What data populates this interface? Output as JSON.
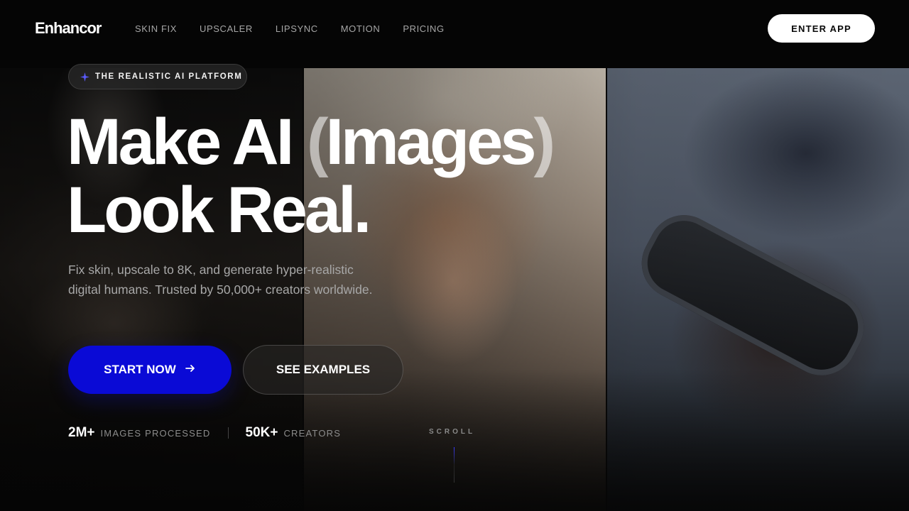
{
  "nav": {
    "logo": "Enhancor",
    "links": [
      "SKIN FIX",
      "UPSCALER",
      "LIPSYNC",
      "MOTION",
      "PRICING"
    ],
    "enter_app": "ENTER APP"
  },
  "hero": {
    "badge_icon": "sparkle-icon",
    "badge": "THE REALISTIC AI PLATFORM",
    "headline_line1_a": "Make AI ",
    "headline_paren_open": "(",
    "headline_images": "Images",
    "headline_paren_close": ")",
    "headline_line2": "Look Real.",
    "subtext": "Fix skin, upscale to 8K, and generate hyper-realistic digital humans. Trusted by 50,000+ creators worldwide.",
    "cta_primary": "START NOW",
    "cta_primary_icon": "arrow-right-icon",
    "cta_secondary": "SEE EXAMPLES",
    "stats": [
      {
        "value": "2M+",
        "label": "IMAGES PROCESSED"
      },
      {
        "value": "50K+",
        "label": "CREATORS"
      }
    ],
    "scroll": "SCROLL"
  },
  "colors": {
    "accent": "#0a0ad6",
    "background": "#050505",
    "text": "#ffffff"
  }
}
